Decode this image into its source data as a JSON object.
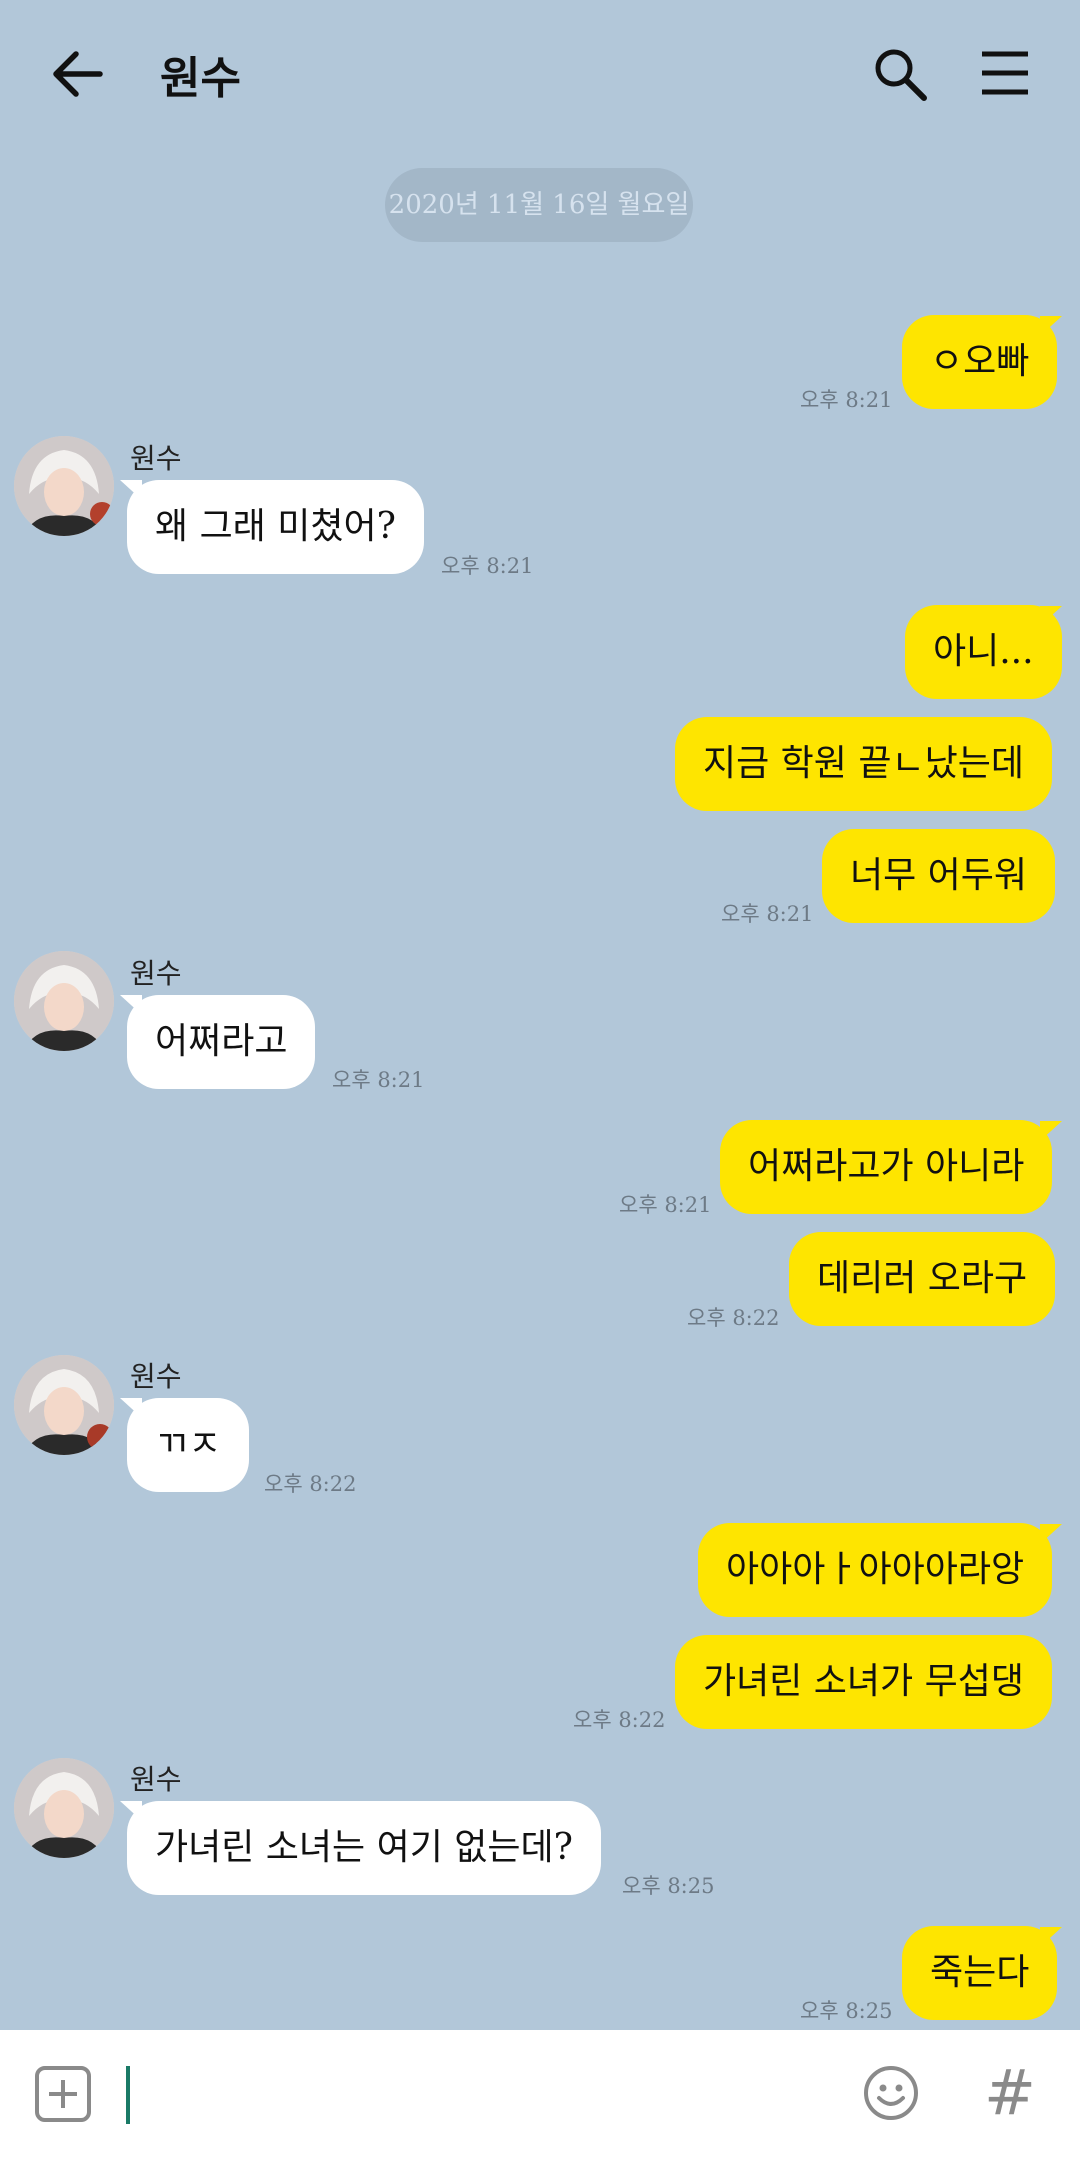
{
  "header": {
    "title": "원수",
    "back_icon": "back-arrow-icon",
    "search_icon": "search-icon",
    "menu_icon": "hamburger-menu-icon"
  },
  "date_divider": "2020년 11월 16일 월요일",
  "messages": [
    {
      "from": "me",
      "text": "ㅇ오빠",
      "time": "오후 8:21"
    },
    {
      "from": "other",
      "sender": "원수",
      "text": "왜 그래 미쳤어?",
      "time": "오후 8:21"
    },
    {
      "from": "me",
      "text": "아니..."
    },
    {
      "from": "me",
      "text": "지금 학원 끝ㄴ났는데"
    },
    {
      "from": "me",
      "text": "너무 어두워",
      "time": "오후 8:21"
    },
    {
      "from": "other",
      "sender": "원수",
      "text": "어쩌라고",
      "time": "오후 8:21"
    },
    {
      "from": "me",
      "text": "어쩌라고가 아니라",
      "time": "오후 8:21"
    },
    {
      "from": "me",
      "text": "데리러 오라구",
      "time": "오후 8:22"
    },
    {
      "from": "other",
      "sender": "원수",
      "text": "ㄲㅈ",
      "time": "오후 8:22"
    },
    {
      "from": "me",
      "text": "아아아ㅏ아아아라앙"
    },
    {
      "from": "me",
      "text": "가녀린 소녀가 무섭댕",
      "time": "오후 8:22"
    },
    {
      "from": "other",
      "sender": "원수",
      "text": "가녀린 소녀는 여기 없는데?",
      "time": "오후 8:25"
    },
    {
      "from": "me",
      "text": "죽는다",
      "time": "오후 8:25"
    }
  ],
  "input_bar": {
    "plus_icon": "plus-square-icon",
    "emoji_icon": "emoji-icon",
    "hash_label": "#"
  },
  "colors": {
    "background": "#b2c7d9",
    "my_bubble": "#fee500",
    "their_bubble": "#ffffff"
  }
}
